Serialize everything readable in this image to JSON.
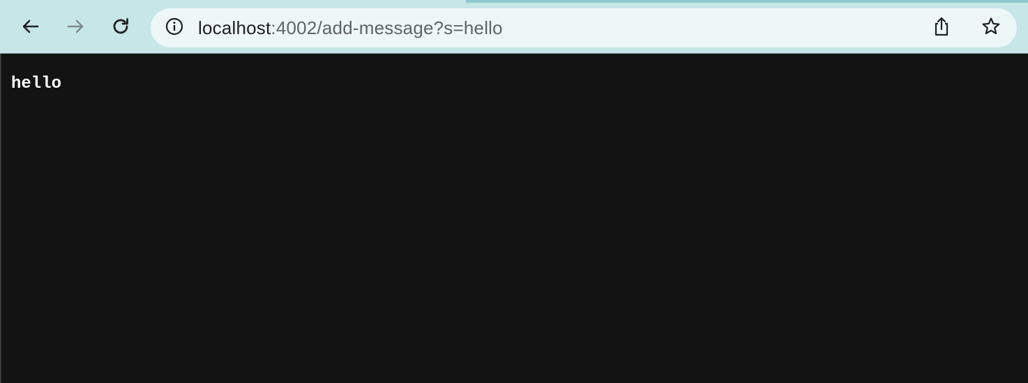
{
  "browser": {
    "url_host": "localhost",
    "url_rest": ":4002/add-message?s=hello",
    "icons": {
      "back": "back-arrow-icon",
      "forward": "forward-arrow-icon",
      "reload": "reload-icon",
      "site_info": "info-icon",
      "share": "share-icon",
      "bookmark": "star-icon"
    },
    "colors": {
      "toolbar": "#c6e6e8",
      "omnibox": "#eef7f8",
      "page_background": "#131313"
    }
  },
  "page": {
    "text": "hello"
  }
}
